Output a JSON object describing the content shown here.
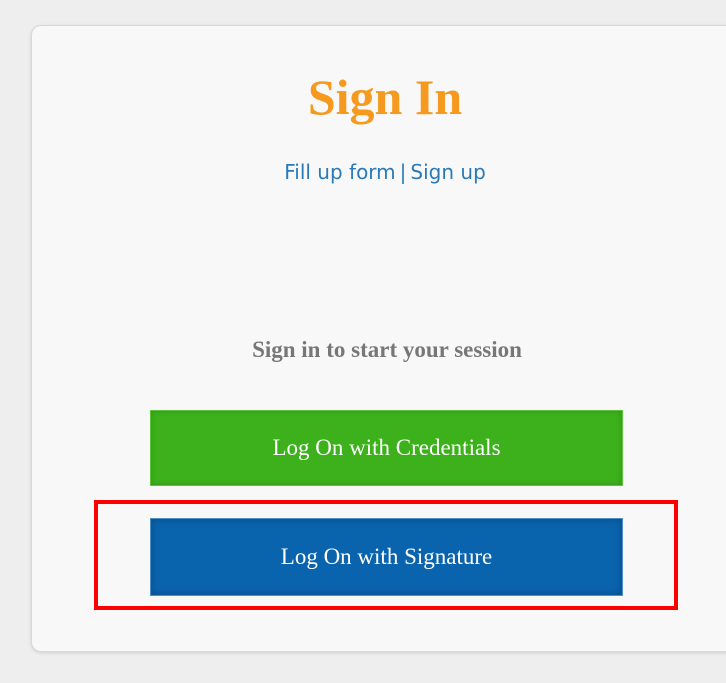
{
  "title": "Sign In",
  "links": {
    "fill_up_form": "Fill up form",
    "separator": "|",
    "sign_up": "Sign up"
  },
  "session_message": "Sign in to start your session",
  "buttons": {
    "credentials": "Log On with Credentials",
    "signature": "Log On with Signature"
  },
  "colors": {
    "title": "#f59a1f",
    "link": "#2a7ab8",
    "credentials_button": "#3cb11b",
    "signature_button": "#0a63ad",
    "highlight": "#ff0000"
  }
}
